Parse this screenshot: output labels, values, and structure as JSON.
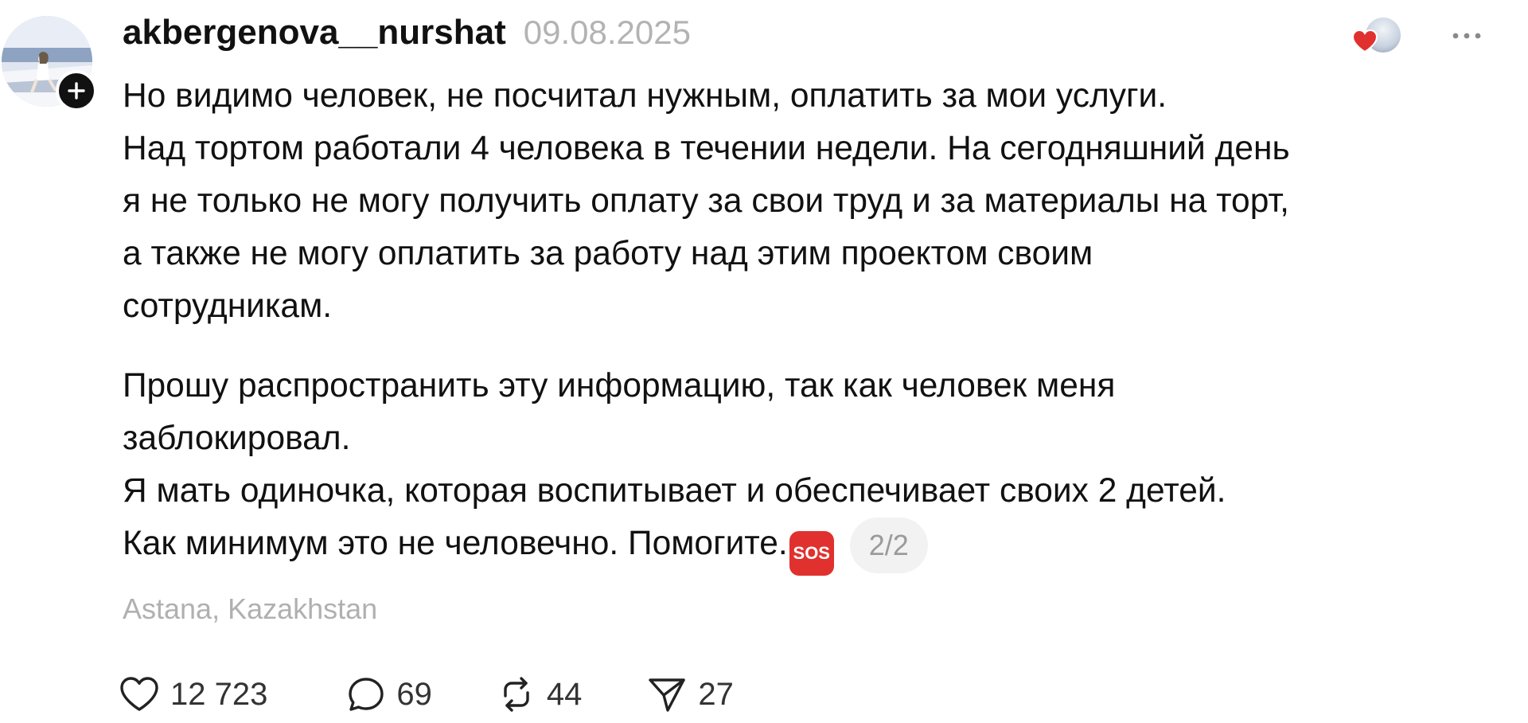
{
  "post": {
    "username": "akbergenova__nurshat",
    "timestamp": "09.08.2025",
    "paragraphs": [
      [
        "Но видимо человек, не посчитал нужным, оплатить за мои услуги.",
        "Над тортом работали 4 человека в течении недели. На сегодняшний день",
        "я не только не могу получить оплату за свои труд и за материалы на торт,",
        "а также не могу оплатить за работу над этим проектом своим",
        "сотрудникам."
      ],
      [
        "Прошу распространить эту информацию, так как человек меня",
        "заблокировал.",
        "Я мать одиночка, которая воспитывает и обеспечивает своих 2 детей.",
        "Как минимум это не человечно. Помогите."
      ]
    ],
    "sos_emoji": "SOS",
    "page_indicator": "2/2",
    "location": "Astana, Kazakhstan"
  },
  "actions": {
    "likes": "12 723",
    "replies": "69",
    "reposts": "44",
    "shares": "27"
  },
  "colors": {
    "text": "#111111",
    "muted": "#b3b3b3",
    "heart": "#e0312e",
    "sos": "#e0312e",
    "pill_bg": "#f2f2f2"
  },
  "icons": {
    "follow": "plus-icon",
    "liked_by": "heart-icon",
    "more": "more-dots-icon",
    "like": "heart-outline-icon",
    "reply": "speech-bubble-icon",
    "repost": "repost-arrows-icon",
    "share": "paper-plane-icon"
  }
}
